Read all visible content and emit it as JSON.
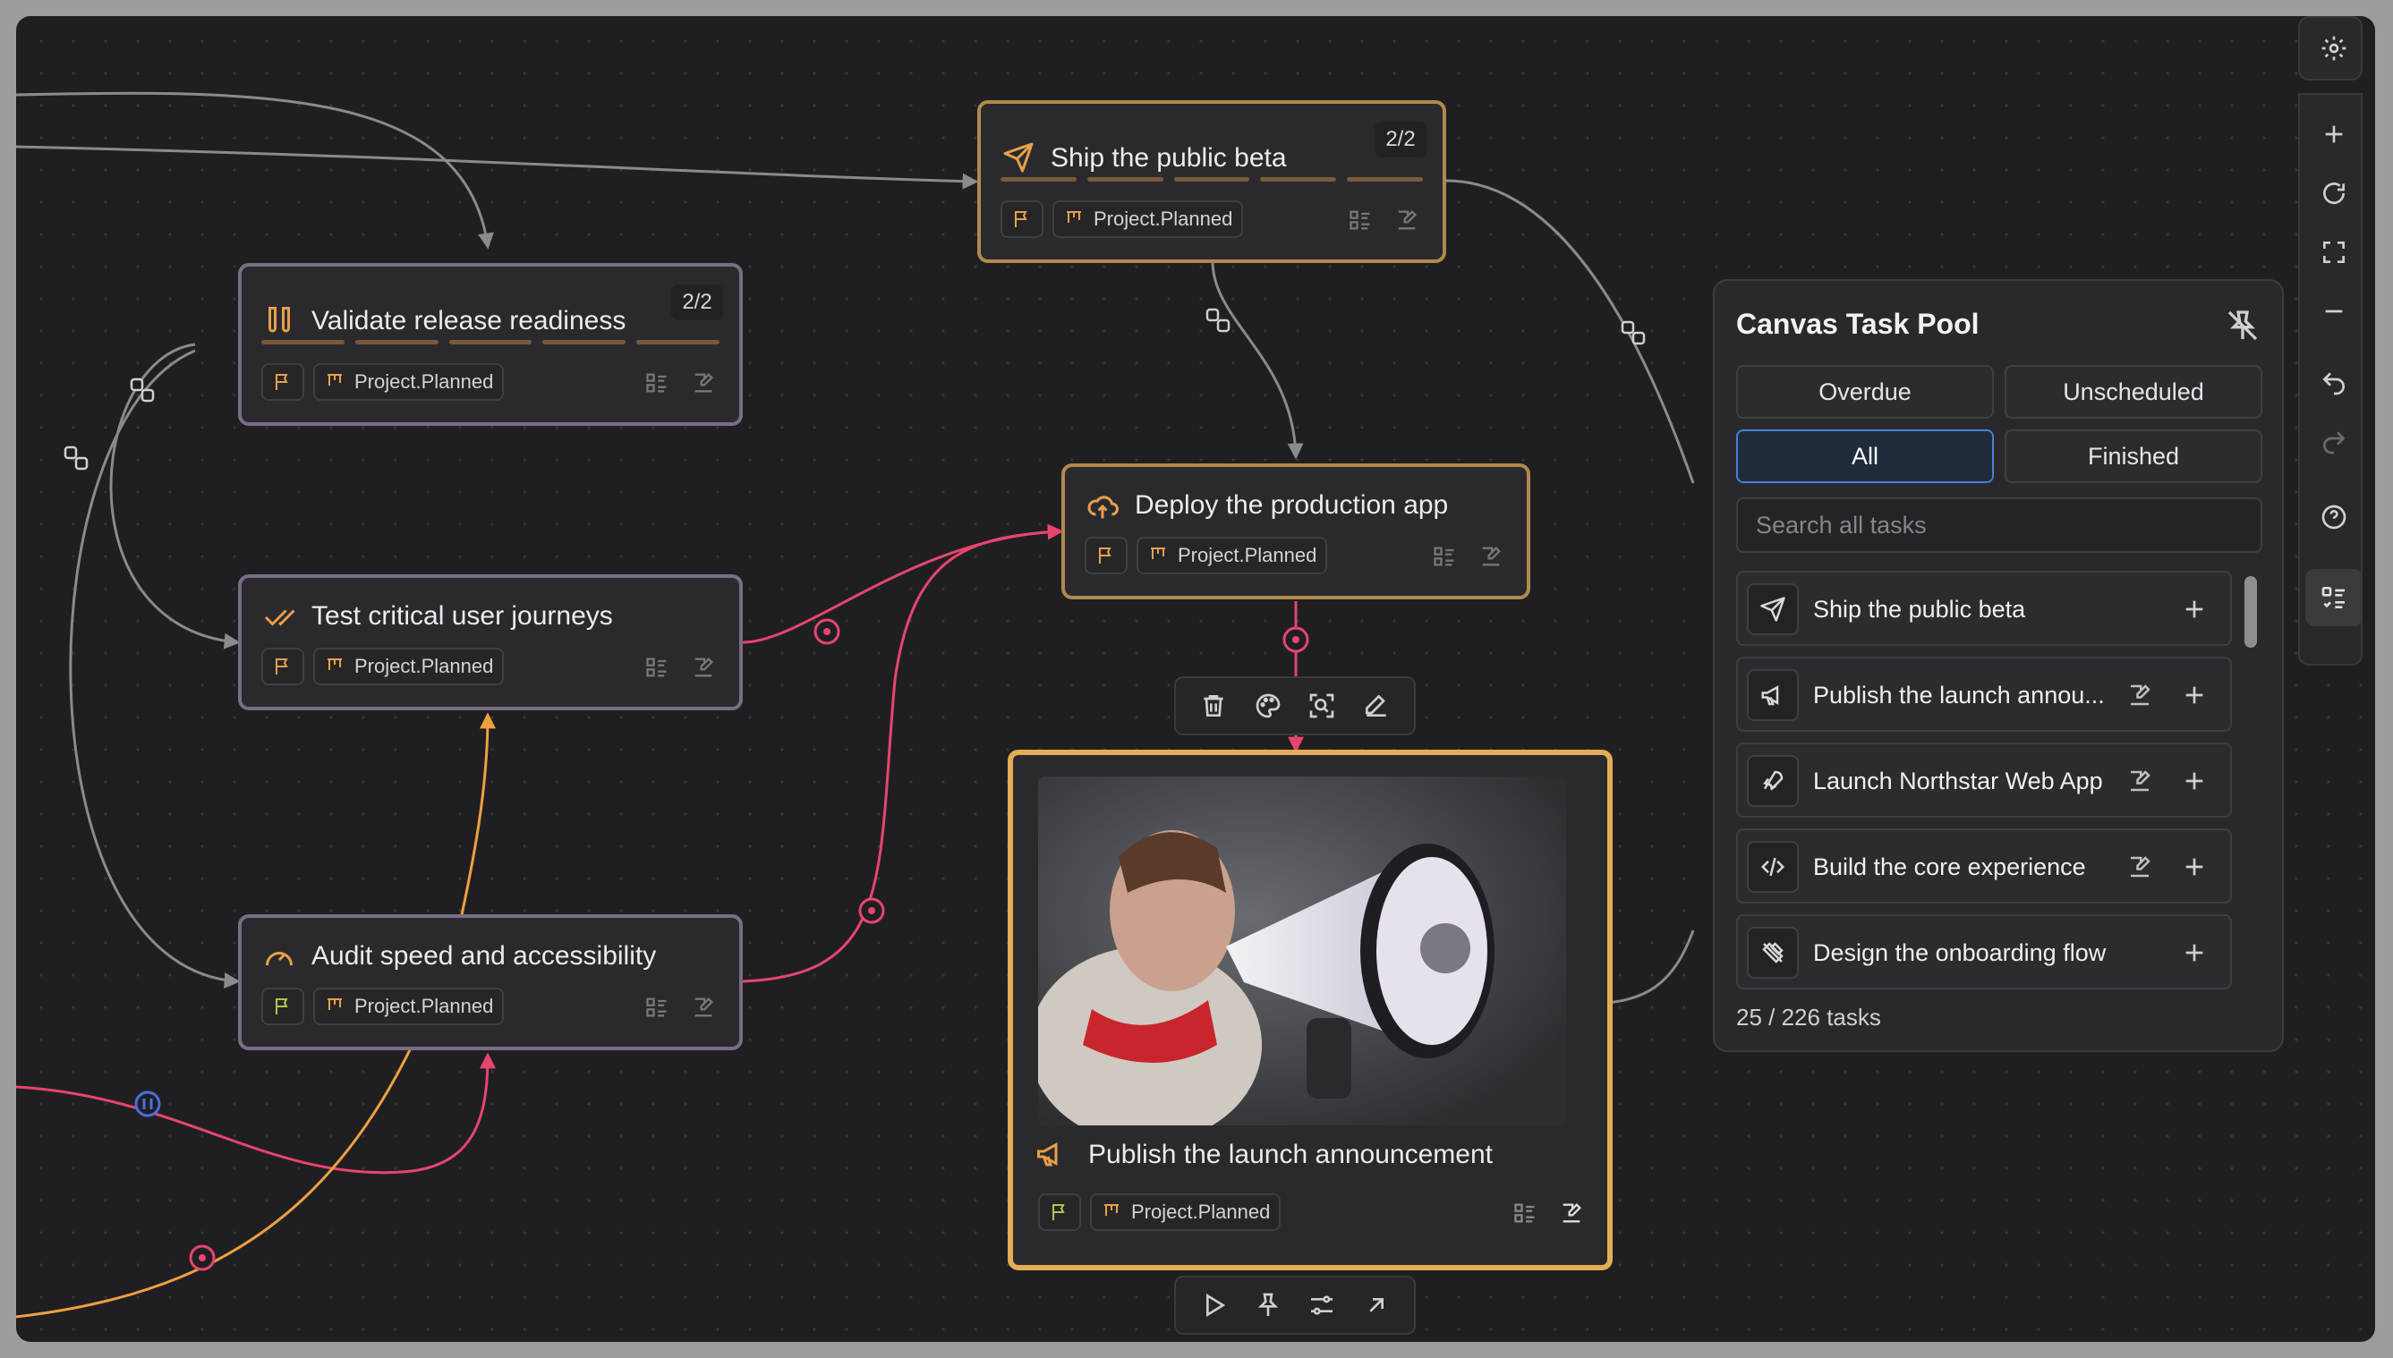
{
  "nodes": {
    "ship": {
      "title": "Ship the public beta",
      "count": "2/2",
      "status": "Project.Planned"
    },
    "validate": {
      "title": "Validate release readiness",
      "count": "2/2",
      "status": "Project.Planned"
    },
    "test": {
      "title": "Test critical user journeys",
      "status": "Project.Planned"
    },
    "deploy": {
      "title": "Deploy the production app",
      "status": "Project.Planned"
    },
    "audit": {
      "title": "Audit speed and accessibility",
      "status": "Project.Planned"
    },
    "publish": {
      "title": "Publish the launch announcement",
      "status": "Project.Planned"
    }
  },
  "pool": {
    "title": "Canvas Task Pool",
    "filters": [
      "Overdue",
      "Unscheduled",
      "All",
      "Finished"
    ],
    "selected_filter": "All",
    "search_placeholder": "Search all tasks",
    "items": [
      {
        "label": "Ship the public beta",
        "icon": "send-icon"
      },
      {
        "label": "Publish the launch annou...",
        "icon": "megaphone-icon"
      },
      {
        "label": "Launch Northstar Web App",
        "icon": "rocket-icon"
      },
      {
        "label": "Build the core experience",
        "icon": "code-icon"
      },
      {
        "label": "Design the onboarding flow",
        "icon": "design-icon"
      }
    ],
    "footer": "25 / 226 tasks"
  },
  "colors": {
    "accent": "#e8a04a",
    "selection": "#4a7ed8",
    "edge_gray": "#8a8a8f",
    "edge_pink": "#e8456e",
    "edge_orange": "#f0a040"
  }
}
